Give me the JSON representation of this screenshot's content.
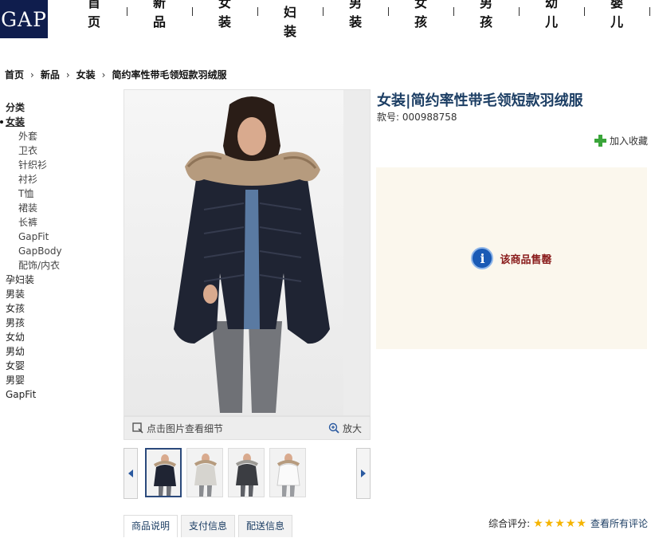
{
  "header": {
    "logo": "GAP",
    "nav": [
      "首页",
      "新品",
      "女装",
      "孕妇装",
      "男装",
      "女孩",
      "男孩",
      "幼儿",
      "婴儿"
    ]
  },
  "breadcrumb": [
    "首页",
    "新品",
    "女装",
    "简约率性带毛领短款羽绒服"
  ],
  "sidebar": {
    "heading": "分类",
    "active": "女装",
    "subitems": [
      "外套",
      "卫衣",
      "针织衫",
      "衬衫",
      "T恤",
      "裙装",
      "长裤",
      "GapFit",
      "GapBody",
      "配饰/内衣"
    ],
    "items": [
      "孕妇装",
      "男装",
      "女孩",
      "男孩",
      "女幼",
      "男幼",
      "女婴",
      "男婴",
      "GapFit"
    ]
  },
  "product": {
    "title": "女装|简约率性带毛领短款羽绒服",
    "code": "款号: 000988758",
    "favorite": "加入收藏",
    "sold_out": "该商品售罄",
    "zoom_hint": "点击图片查看细节",
    "zoom_button": "放大"
  },
  "tabs": [
    "商品说明",
    "支付信息",
    "配送信息"
  ],
  "rating": {
    "label": "综合评分:",
    "stars": 5,
    "link": "查看所有评论"
  },
  "colors": {
    "brand_navy": "#0f1d4d",
    "title_blue": "#1c3e64",
    "soldout_red": "#8a1c1c",
    "soldout_bg": "#fbf7ed",
    "star": "#f5b400",
    "plus_green": "#3aa53a"
  },
  "icons": [
    "gap-logo",
    "chevron-right-icon",
    "magnifier-icon",
    "zoom-in-icon",
    "arrow-left-icon",
    "arrow-right-icon",
    "plus-icon",
    "info-icon",
    "star-icon"
  ]
}
